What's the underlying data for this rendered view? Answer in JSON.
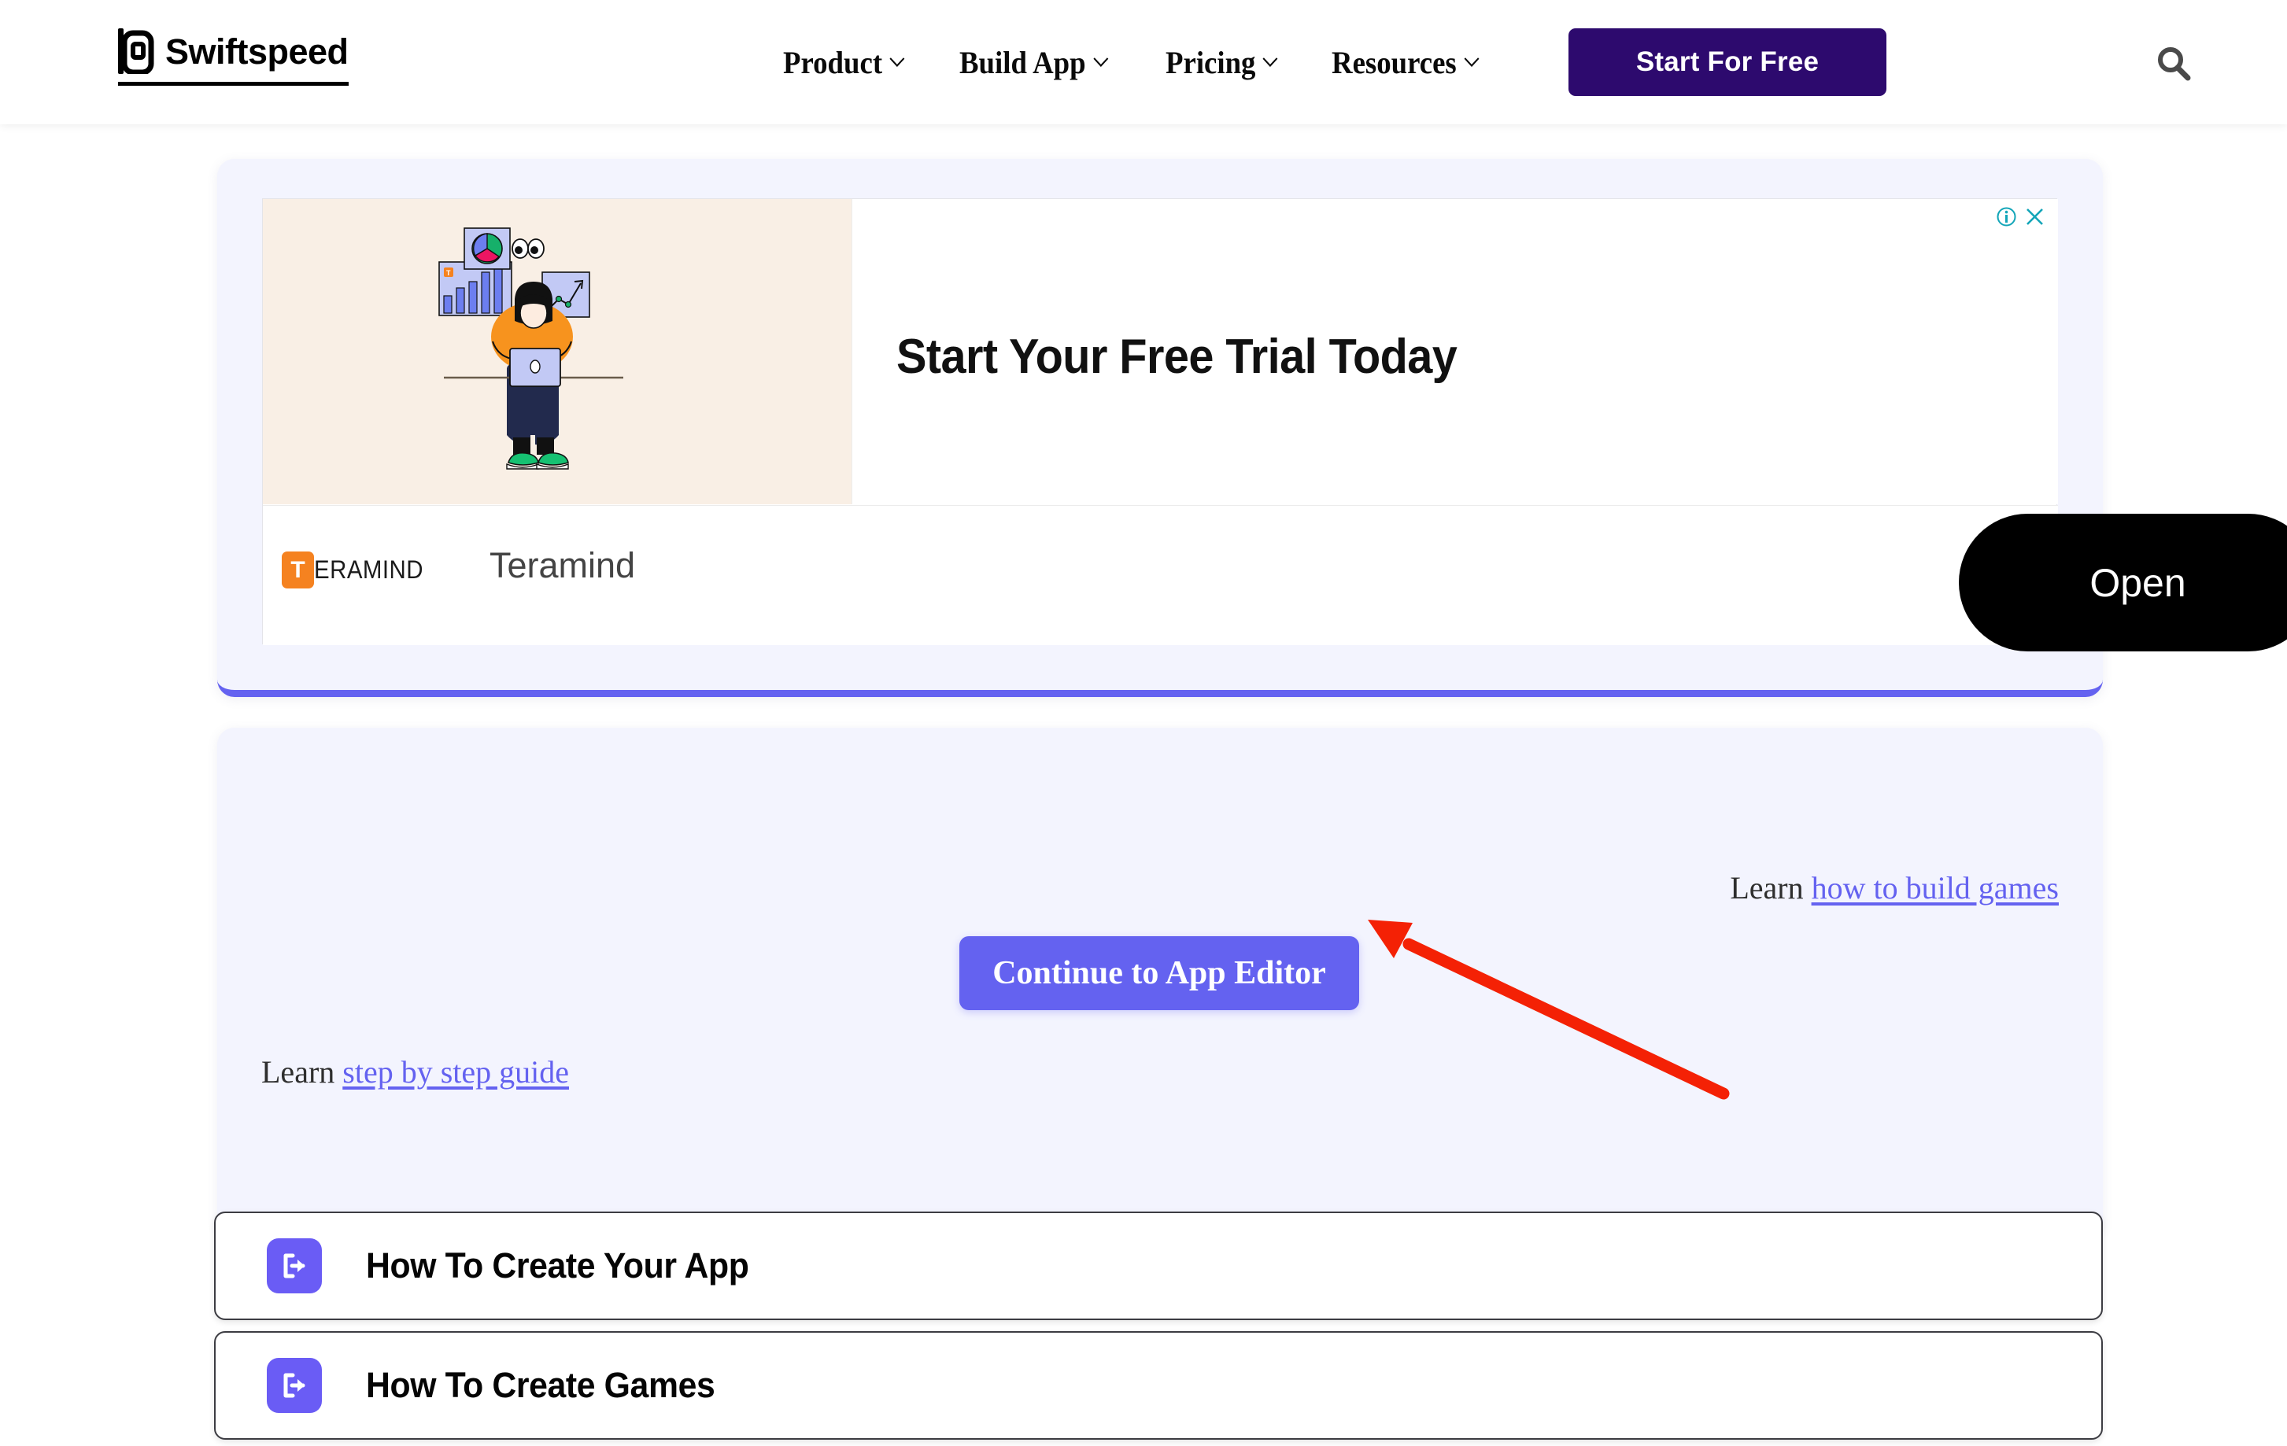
{
  "header": {
    "brand": "Swiftspeed",
    "logo_icon": "phone-logo-icon",
    "nav": [
      {
        "label": "Product",
        "icon": "chevron-down-icon"
      },
      {
        "label": "Build App",
        "icon": "chevron-down-icon"
      },
      {
        "label": "Pricing",
        "icon": "chevron-down-icon"
      },
      {
        "label": "Resources",
        "icon": "chevron-down-icon"
      }
    ],
    "cta_label": "Start For Free",
    "search_icon": "search-icon"
  },
  "ad": {
    "headline": "Start Your Free Trial Today",
    "advertiser_badge_letter": "T",
    "advertiser_badge_rest": "ERAMIND",
    "advertiser_name": "Teramind",
    "open_label": "Open",
    "info_icon": "ad-info-icon",
    "close_icon": "ad-close-icon",
    "illustration": "person-with-laptop-and-charts-illustration"
  },
  "editor": {
    "learn_games_prefix": "Learn ",
    "learn_games_link": "how to build games",
    "continue_label": "Continue to App Editor",
    "learn_guide_prefix": "Learn ",
    "learn_guide_link": "step by step guide",
    "annotation_arrow": "red-pointer-arrow"
  },
  "accordion": {
    "items": [
      {
        "label": "How To Create Your App",
        "icon": "exit-arrow-icon"
      },
      {
        "label": "How To Create Games",
        "icon": "exit-arrow-icon"
      }
    ]
  },
  "colors": {
    "brand_dark_purple": "#2d0a6e",
    "accent_purple": "#6462f0",
    "card_bg": "#f3f4fe",
    "ad_visual_bg": "#f9efe5",
    "annotation_red": "#f42105",
    "ad_control_teal": "#12a5b8"
  }
}
